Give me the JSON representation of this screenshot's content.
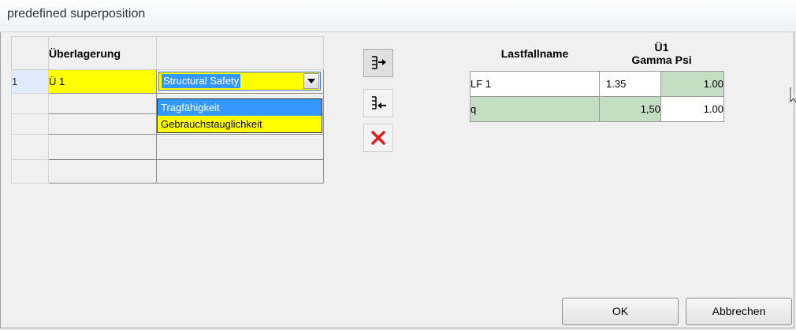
{
  "window": {
    "title": "predefined superposition"
  },
  "left_grid": {
    "header": {
      "col1": "Überlagerung",
      "col2": ""
    },
    "rows": [
      {
        "num": "1",
        "name": "Ü 1",
        "type": "Structural Safety"
      },
      {
        "num": "",
        "name": "",
        "type": ""
      },
      {
        "num": "",
        "name": "",
        "type": ""
      },
      {
        "num": "",
        "name": "",
        "type": ""
      },
      {
        "num": "",
        "name": "",
        "type": ""
      }
    ]
  },
  "dropdown": {
    "options": [
      "Tragfähigkeit",
      "Gebrauchstauglichkeit"
    ],
    "highlighted": "Tragfähigkeit"
  },
  "tools": [
    {
      "icon": "add-arrow-icon"
    },
    {
      "icon": "remove-arrow-icon"
    },
    {
      "icon": "delete-x-icon"
    }
  ],
  "right_grid": {
    "header": {
      "name": "Lastfallname",
      "group": "Ü1",
      "gamma": "Gamma",
      "psi": "Psi"
    },
    "rows": [
      {
        "name": "LF 1",
        "gamma": "1.35",
        "psi": "1.00"
      },
      {
        "name": "q",
        "gamma": "1,50",
        "psi": "1.00"
      }
    ]
  },
  "buttons": {
    "ok": "OK",
    "cancel": "Abbrechen"
  },
  "colors": {
    "yellow": "#ffff00",
    "selection": "#3399ff",
    "green": "#c4dec4"
  }
}
